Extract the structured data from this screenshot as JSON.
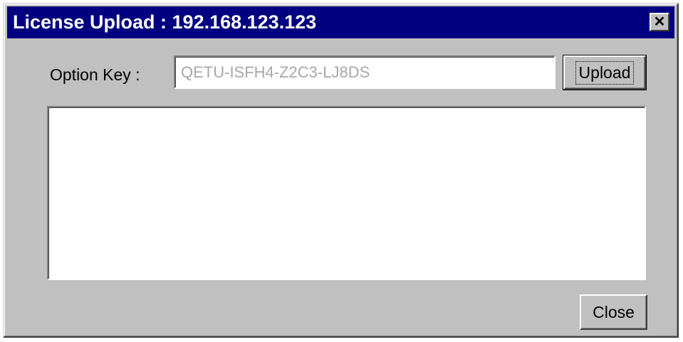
{
  "window": {
    "title": "License Upload : 192.168.123.123",
    "close_glyph": "✕",
    "close_icon": "close-icon"
  },
  "form": {
    "option_key_label": "Option Key :",
    "option_key_value": "QETU-ISFH4-Z2C3-LJ8DS",
    "upload_label": "Upload",
    "log_text": ""
  },
  "footer": {
    "close_label": "Close"
  },
  "colors": {
    "titlebar": "#000080",
    "face": "#c0c0c0"
  }
}
